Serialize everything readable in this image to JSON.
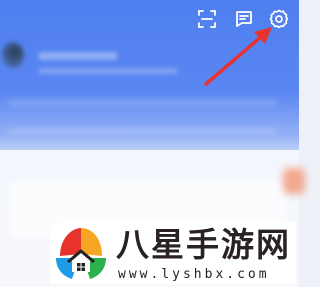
{
  "header": {
    "icons": [
      "scan-icon",
      "message-icon",
      "settings-icon"
    ],
    "bg_color": "#5a86f2"
  },
  "annotation": {
    "arrow_color": "#e8322e",
    "points_to": "settings-icon"
  },
  "watermark": {
    "brand_name": "八星手游网",
    "url": "www.lyshbx.com",
    "logo_colors": [
      "#e8322e",
      "#f5a623",
      "#1e9be8",
      "#2bb24c",
      "#f2d600"
    ]
  }
}
